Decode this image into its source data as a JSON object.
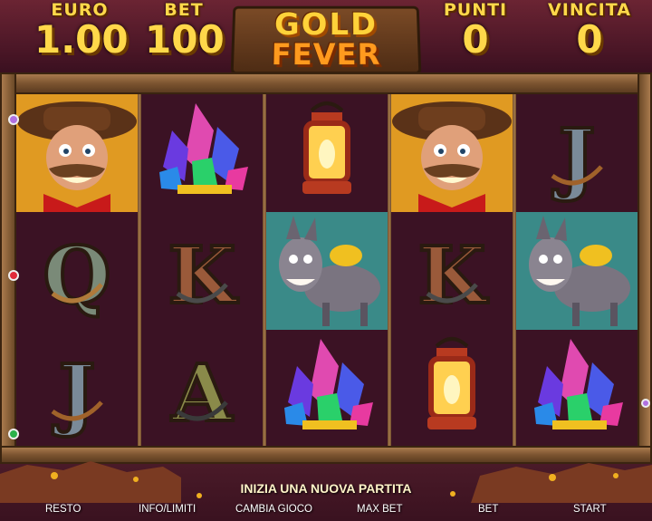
{
  "meters": {
    "euro": {
      "label": "EURO",
      "value": "1.00"
    },
    "bet": {
      "label": "BET",
      "value": "100"
    },
    "punti": {
      "label": "PUNTI",
      "value": "0"
    },
    "vincita": {
      "label": "VINCITA",
      "value": "0"
    }
  },
  "logo": {
    "line1": "GOLD",
    "line2": "FEVER"
  },
  "reels": [
    [
      "miner",
      "ten",
      "jack"
    ],
    [
      "crystals",
      "king",
      "ace"
    ],
    [
      "lantern",
      "donkey",
      "crystals"
    ],
    [
      "miner",
      "king",
      "lantern"
    ],
    [
      "jack",
      "donkey",
      "crystals"
    ]
  ],
  "symbol_letters": {
    "ten": "Q",
    "jack": "J",
    "king": "K",
    "ace": "A"
  },
  "colors": {
    "marker_top": "#b070e0",
    "marker_mid": "#e02a3a",
    "marker_bottom": "#2ab04a",
    "gold": "#ffd84a"
  },
  "message": "INIZIA UNA NUOVA PARTITA",
  "buttons": {
    "resto": "RESTO",
    "info": "INFO/LIMITI",
    "cambia": "CAMBIA GIOCO",
    "maxbet": "MAX BET",
    "bet": "BET",
    "start": "START"
  }
}
